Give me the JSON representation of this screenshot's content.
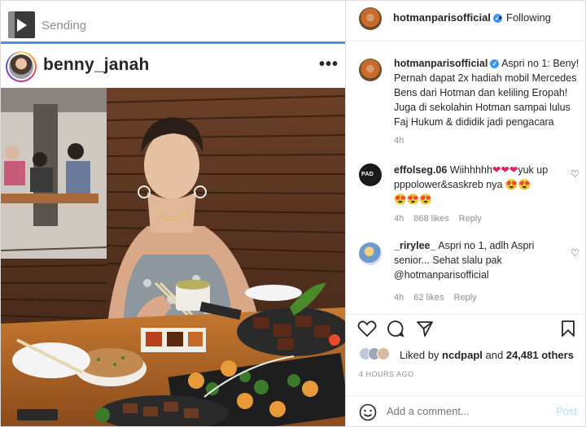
{
  "upload": {
    "status": "Sending",
    "progress": 1.0
  },
  "post": {
    "username": "benny_janah",
    "more_icon": "more-horizontal-icon"
  },
  "panel": {
    "author": "hotmanparisofficial",
    "separator": "•",
    "follow_status": "Following",
    "caption_author": "hotmanparisofficial",
    "caption_text": "Aspri no 1: Beny! Pernah dapat 2x hadiah mobil Mercedes Bens dari Hotman dan keliling Eropah! Juga di sekolahin Hotman sampai lulus Faj Hukum & dididik jadi pengacara",
    "caption_time": "4h",
    "comments": [
      {
        "user": "effolseg.06",
        "text_lines": [
          "Wiihhhhh",
          "yuk",
          "up pppolower&saskreb nya"
        ],
        "time": "4h",
        "likes": "868 likes",
        "reply": "Reply"
      },
      {
        "user": "_rirylee_",
        "text": "Aspri no 1, adlh Aspri senior... Sehat slalu pak @hotmanparisofficial",
        "time": "4h",
        "likes": "62 likes",
        "reply": "Reply"
      }
    ],
    "liked_by_prefix": "Liked by",
    "liked_by_user": "ncdpapl",
    "liked_by_and": "and",
    "liked_by_count": "24,481 others",
    "time_ago": "4 HOURS AGO",
    "add_comment_placeholder": "Add a comment...",
    "post_label": "Post"
  },
  "colors": {
    "accent": "#3897f0",
    "progress": "#4a90e2",
    "muted": "#8e8e8e",
    "post_disabled": "#b2dffc"
  }
}
